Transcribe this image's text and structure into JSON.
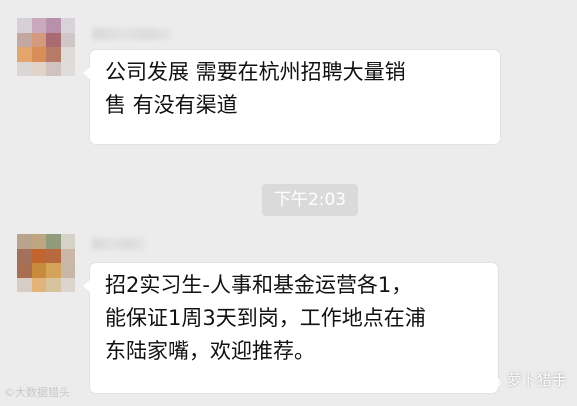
{
  "messages": [
    {
      "lines": [
        "公司发展 需要在杭州招聘大量销",
        "售 有没有渠道"
      ]
    },
    {
      "lines": [
        "招2实习生-人事和基金运营各1，",
        "能保证1周3天到岗，工作地点在浦",
        "东陆家嘴，欢迎推荐。"
      ]
    }
  ],
  "timestamp": "下午2:03",
  "watermark": {
    "left": "©大数据猎头",
    "right": "萝卜猎手",
    "right_icon": "wechat-account-icon"
  },
  "avatars": [
    {
      "colors": [
        "#d7cfd6",
        "#c9a9bb",
        "#b98fae",
        "#d8d3d8",
        "#c4a7a0",
        "#d39a7d",
        "#a96b72",
        "#cfc6c8",
        "#e3a56c",
        "#d98e57",
        "#b67a66",
        "#dedbd9",
        "#d9d6d5",
        "#e2d3c8",
        "#cfc2bf",
        "#e0dcda"
      ]
    },
    {
      "colors": [
        "#b9a38c",
        "#c0a582",
        "#8f9b7a",
        "#d7d2c8",
        "#a3705c",
        "#c1652f",
        "#b86a3e",
        "#cbb7a8",
        "#a96d52",
        "#c88b3d",
        "#d6a35b",
        "#c7b7a6",
        "#d8cdc4",
        "#e0b47a",
        "#d8c39f",
        "#dcd5cd"
      ]
    }
  ]
}
